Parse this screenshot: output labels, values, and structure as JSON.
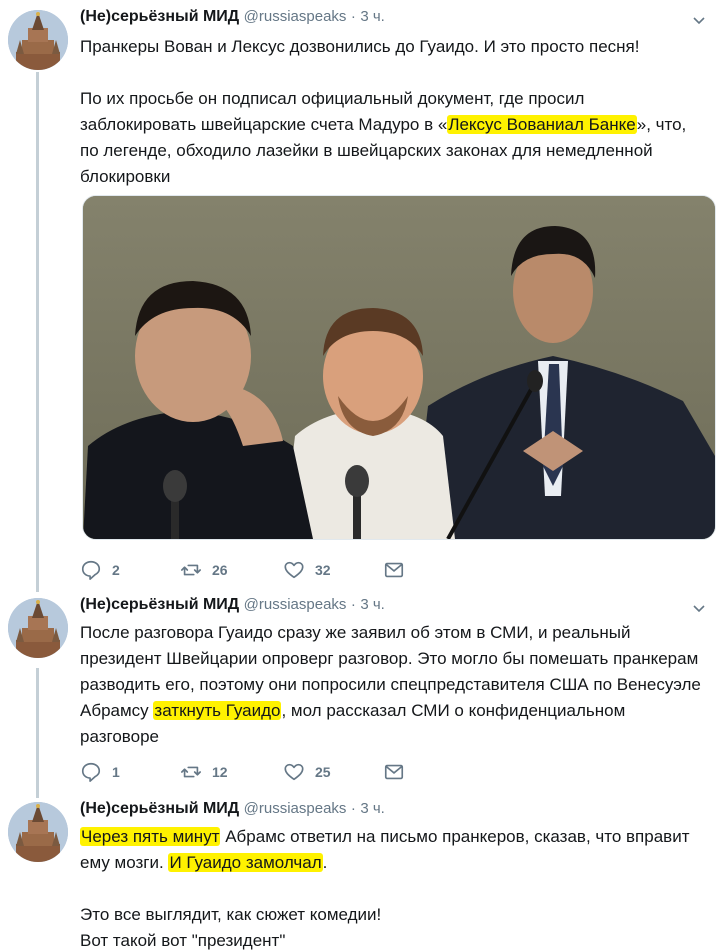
{
  "account": {
    "name": "(Не)серьёзный МИД",
    "handle": "@russiaspeaks",
    "separator": "·"
  },
  "tweets": [
    {
      "time": "3 ч.",
      "p1": "Пранкеры Вован и Лексус дозвонились до Гуаидо. И это просто песня!",
      "p2_before": "По их просьбе он подписал официальный документ, где просил заблокировать швейцарские счета Мадуро в «",
      "p2_hl": "Лексус Вованиал Банке",
      "p2_after": "», что, по легенде, обходило лазейки в швейцарских законах для немедленной блокировки",
      "replies": "2",
      "retweets": "26",
      "likes": "32"
    },
    {
      "time": "3 ч.",
      "p1_before": "После разговора Гуаидо сразу же заявил об этом в СМИ, и реальный президент Швейцарии опроверг разговор. Это могло бы помешать пранкерам разводить его, поэтому они попросили спецпредставителя США по Венесуэле Абрамсу ",
      "p1_hl": "заткнуть Гуаидо",
      "p1_after": ", мол рассказал СМИ о конфиденциальном разговоре",
      "replies": "1",
      "retweets": "12",
      "likes": "25"
    },
    {
      "time": "3 ч.",
      "p1_hl1": "Через пять минут",
      "p1_mid": " Абрамс ответил на письмо пранкеров, сказав, что вправит ему мозги. ",
      "p1_hl2": "И Гуаидо замолчал",
      "p1_end": ".",
      "p2_line1": "Это все выглядит, как сюжет комедии!",
      "p2_line2": "Вот такой вот \"президент\""
    }
  ],
  "colors": {
    "text": "#14171a",
    "secondary": "#657786",
    "highlight": "#fff200",
    "thread_line": "#c4cfd6"
  },
  "icons": [
    "reply-icon",
    "retweet-icon",
    "like-icon",
    "message-icon",
    "chevron-down-icon",
    "kremlin-avatar"
  ]
}
